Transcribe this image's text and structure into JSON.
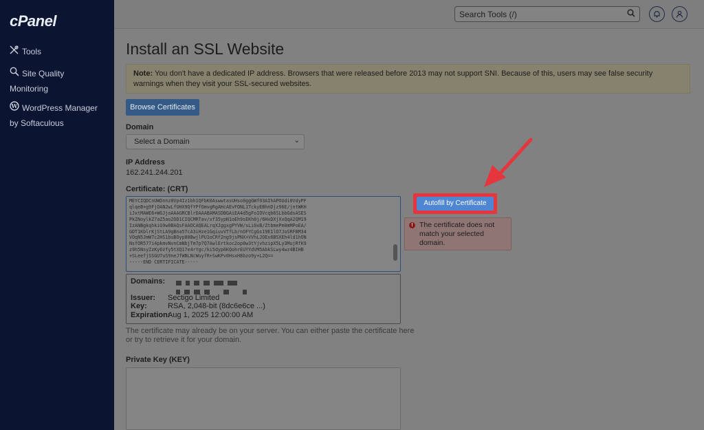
{
  "app": {
    "logo": "cPanel"
  },
  "sidebar": {
    "items": [
      {
        "label": "Tools",
        "icon": "tools-icon"
      },
      {
        "label": "Site Quality",
        "label2": "Monitoring",
        "icon": "magnifier-icon"
      },
      {
        "label": "WordPress Manager",
        "label2": "by Softaculous",
        "icon": "wordpress-icon"
      }
    ]
  },
  "header": {
    "search_placeholder": "Search Tools (/)",
    "search_icon": "search-icon",
    "bell_icon": "bell-icon",
    "user_icon": "user-icon"
  },
  "page": {
    "title": "Install an SSL Website",
    "note_bold": "Note:",
    "note_text": "You don't have a dedicated IP address. Browsers that were released before 2013 may not support SNI. Because of this, users may see false security warnings when they visit your SSL-secured websites.",
    "browse_button": "Browse Certificates",
    "domain_label": "Domain",
    "domain_select": "Select a Domain",
    "ip_label": "IP Address",
    "ip_value": "162.241.244.201",
    "crt_label": "Certificate: (CRT)",
    "crt_lines": [
      "MEYCIQDCnUWDnnz0Vp4Iz1bh1QFbK0AswwtasUHso0ggGWf03AIhAPOUdi0VdyPF",
      "qlqeB+g9FjOAN2wLfUHX9QfYPfOmvgRgAHcAEvFONL1TckyEBhnDjz96E/jntWKH",
      "iJxtMAWE6+WGJjoAAAGRCBlrDAAABAMASDBGAiEA4d5gFoIOVcqb6SLbbGdsASES",
      "PkZNoylkZ7aZ5ao2OD1CIQCMRTav/xf35ypN1oEh9sEKh0j/6HxDXjXxQqA2QM19",
      "IzANBgkqhkiG9w0BAQsFAAOCAQEALrqXJggxgPYVW/sLi0xB/ZtbmePm0mMPoEA/",
      "GDT1KblrKjStLA9gBna57cA3iHze1GqiuvVTfLb/nOFYCgGs19E1lO7JoSRFBM34",
      "VOqN5JmW7c2HS1buBOyp80BwjlPU1oCRf2ng9jsPNX+VVhLJOEx6BSXEh4ld1hON",
      "NsfOR577i4pkmvNvnCmNbjTm7p7Q7AwlErtkoc2op0w3tYjvhzipX5Ly3MujRfK9",
      "z9h5NsyZzKy6Vfy5tXQ17e4rYgc/ki5dyp6KQohrEUYYdVM5AbkSLwy4wz4BIHB",
      "+SLeefjSSGU7uS9neJfWBLNcWuyfR+SwKPv0HsxH8bzo9y+L2Q==",
      "-----END CERTIFICATE-----"
    ],
    "cert_info": {
      "domains_key": "Domains:",
      "issuer_key": "Issuer:",
      "issuer_value": "Sectigo Limited",
      "key_key": "Key:",
      "key_value": "RSA, 2,048-bit (8dc6e6ce ...)",
      "expiration_key": "Expiration:",
      "expiration_value": "Aug 1, 2025 12:00:00 AM"
    },
    "help_text": "The certificate may already be on your server. You can either paste the certificate here or try to retrieve it for your domain.",
    "pk_label": "Private Key (KEY)",
    "autofill_button": "Autofill by Certificate",
    "error_text": "The certificate does not match your selected domain.",
    "error_icon": "exclamation-icon"
  },
  "colors": {
    "highlight": "#e5363e",
    "autofill": "#4f86d4",
    "sidebar": "#0b1430"
  }
}
